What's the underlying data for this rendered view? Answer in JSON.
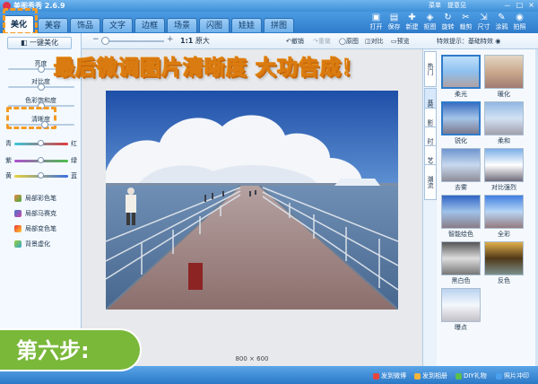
{
  "window": {
    "title": "美图秀秀 2.6.9",
    "links": [
      "菜单",
      "提意见"
    ],
    "win_buttons": [
      "－",
      "□",
      "×"
    ]
  },
  "tabs": [
    {
      "label": "美化",
      "active": true
    },
    {
      "label": "美容"
    },
    {
      "label": "饰品"
    },
    {
      "label": "文字"
    },
    {
      "label": "边框"
    },
    {
      "label": "场景"
    },
    {
      "label": "闪图"
    },
    {
      "label": "娃娃"
    },
    {
      "label": "拼图"
    }
  ],
  "toolbar": {
    "buttons": [
      {
        "label": "打开",
        "icon": "open-folder-icon"
      },
      {
        "label": "保存",
        "icon": "save-disk-icon"
      },
      {
        "label": "新建",
        "icon": "new-file-icon"
      },
      {
        "label": "抠图",
        "icon": "cutout-icon"
      },
      {
        "label": "旋转",
        "icon": "rotate-icon"
      },
      {
        "label": "裁剪",
        "icon": "crop-icon"
      },
      {
        "label": "尺寸",
        "icon": "resize-icon"
      },
      {
        "label": "涂鸦",
        "icon": "doodle-icon"
      },
      {
        "label": "拍照",
        "icon": "camera-icon"
      }
    ]
  },
  "left_panel": {
    "one_key_label": "一键美化",
    "sliders": [
      {
        "label": "亮度",
        "value": 0.5
      },
      {
        "label": "对比度",
        "value": 0.5
      },
      {
        "label": "色彩饱和度",
        "value": 0.5
      },
      {
        "label": "清晰度",
        "value": 0.55
      }
    ],
    "color_rows": [
      {
        "left": "青",
        "right": "红"
      },
      {
        "left": "紫",
        "right": "绿"
      },
      {
        "left": "黄",
        "right": "蓝"
      }
    ],
    "tools": [
      {
        "label": "局部彩色笔"
      },
      {
        "label": "局部马赛克"
      },
      {
        "label": "局部变色笔"
      },
      {
        "label": "背景虚化"
      }
    ]
  },
  "view_toolbar": {
    "zoom_minus": "−",
    "zoom_plus": "+",
    "zoom_value": 0.05,
    "one_to_one": "1:1",
    "original_size": "原大",
    "undo": "撤销",
    "redo": "重做",
    "original": "原图",
    "compare": "对比",
    "preview": "预览"
  },
  "canvas": {
    "dimensions": "800 × 600"
  },
  "effects": {
    "header": "特效提示：基础特效",
    "side_tabs": [
      "热门",
      "基础",
      "影楼",
      "时尚",
      "艺术",
      "潮流"
    ],
    "items": [
      {
        "label": "柔光",
        "selected": true
      },
      {
        "label": "暖化"
      },
      {
        "label": "锐化",
        "selected": true
      },
      {
        "label": "柔和"
      },
      {
        "label": "去雾"
      },
      {
        "label": "对比强烈"
      },
      {
        "label": "智能绘色"
      },
      {
        "label": "全彩"
      },
      {
        "label": "黑白色"
      },
      {
        "label": "反色"
      },
      {
        "label": "曝点"
      }
    ]
  },
  "statusbar": {
    "items": [
      "发到微博",
      "发到相册",
      "DIY礼物",
      "照片冲印"
    ]
  },
  "overlay": {
    "headline": "最后微调图片清晰度 大功告成！",
    "step": "第六步:"
  },
  "colors": {
    "accent": "#2f7ccb",
    "highlight": "#f59a23",
    "step_green": "#7ab83a"
  }
}
